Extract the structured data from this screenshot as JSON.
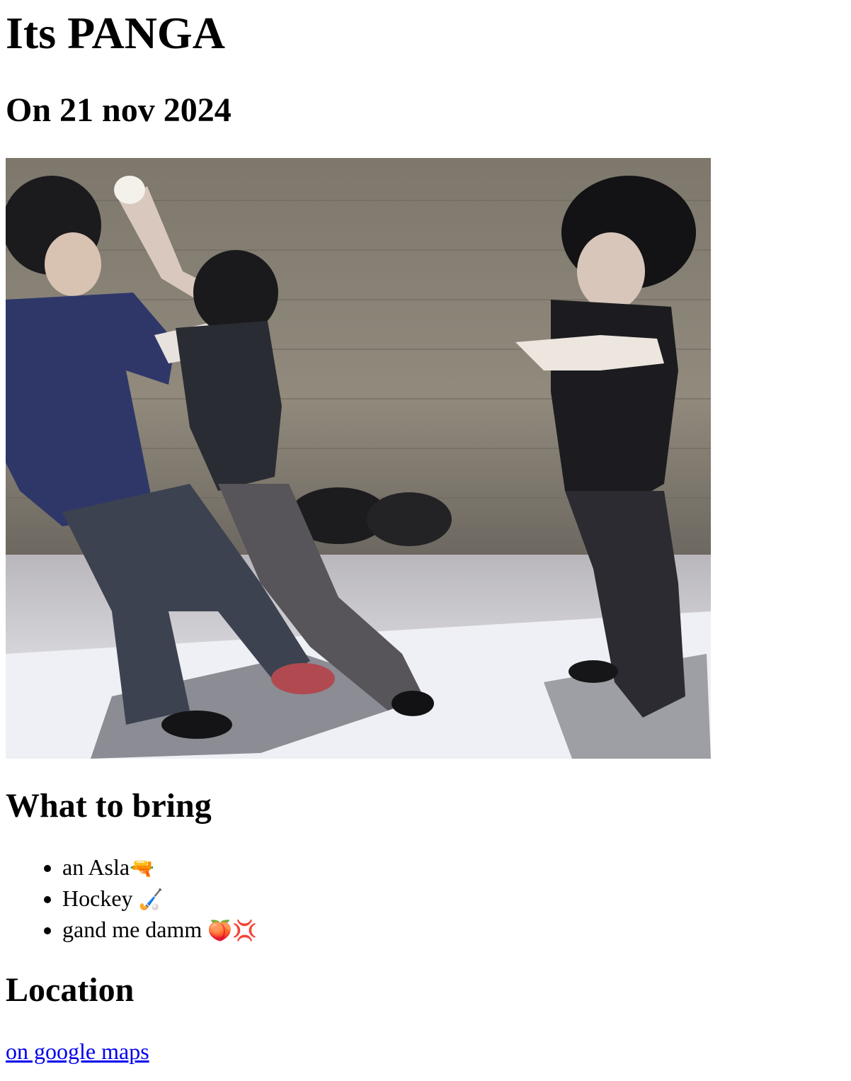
{
  "header": {
    "title": "Its PANGA",
    "date": "On 21 nov 2024"
  },
  "hero": {
    "subject": "three people play-fighting in front of a brick wall"
  },
  "bring": {
    "heading": "What to bring",
    "items": [
      {
        "text": "an Asla",
        "emoji": "🔫",
        "emoji_name": "water-pistol-icon"
      },
      {
        "text": "Hockey ",
        "emoji": "🏑",
        "emoji_name": "field-hockey-icon"
      },
      {
        "text": "gand me damm ",
        "emoji": "🍑💢",
        "emoji_name": "peach-anger-icon"
      }
    ]
  },
  "location": {
    "heading": "Location",
    "link_text": "on google maps"
  },
  "colors": {
    "link": "#0000ee",
    "text": "#000000",
    "background": "#ffffff"
  }
}
